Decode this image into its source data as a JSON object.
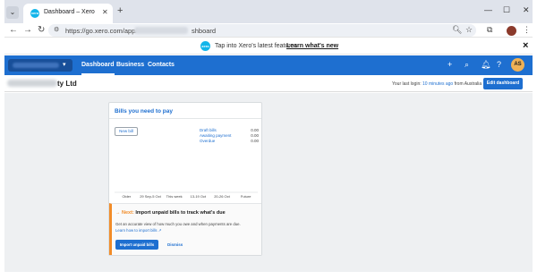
{
  "browser": {
    "tab_title": "Dashboard – Xero",
    "url": "https://go.xero.com/app/",
    "url_tail": "shboard",
    "favicon_text": "xero"
  },
  "banner": {
    "message": "Tap into Xero's latest features.",
    "link": "Learn what's new"
  },
  "nav": {
    "items": [
      "Dashboard",
      "Business",
      "Contacts"
    ],
    "avatar_initials": "AS"
  },
  "org": {
    "name_suffix": "ty Ltd",
    "last_login_prefix": "Your last login:",
    "last_login_ago": "10 minutes ago",
    "last_login_suffix": "from Australia",
    "edit_button": "Edit dashboard"
  },
  "bills_card": {
    "title": "Bills you need to pay",
    "new_bill": "New bill",
    "summary": [
      {
        "label": "Draft bills",
        "value": "0.00"
      },
      {
        "label": "Awaiting payment",
        "value": "0.00"
      },
      {
        "label": "Overdue",
        "value": "0.00"
      }
    ],
    "next": {
      "tag": "Next:",
      "title": "Import unpaid bills to track what's due",
      "description": "Get an accurate view of how much you owe and when payments are due.",
      "link": "Learn how to import bills",
      "import_button": "Import unpaid bills",
      "dismiss": "Dismiss"
    }
  },
  "chart_data": {
    "type": "bar",
    "categories": [
      "Older",
      "29 Sep-5 Oct",
      "This week",
      "13-19 Oct",
      "20-26 Oct",
      "Future"
    ],
    "values": [
      0,
      0,
      0,
      0,
      0,
      0
    ],
    "title": "",
    "xlabel": "",
    "ylabel": ""
  },
  "colors": {
    "brand_blue": "#1e6fd0",
    "accent_orange": "#f28c28",
    "xero_cyan": "#13b5ea"
  }
}
